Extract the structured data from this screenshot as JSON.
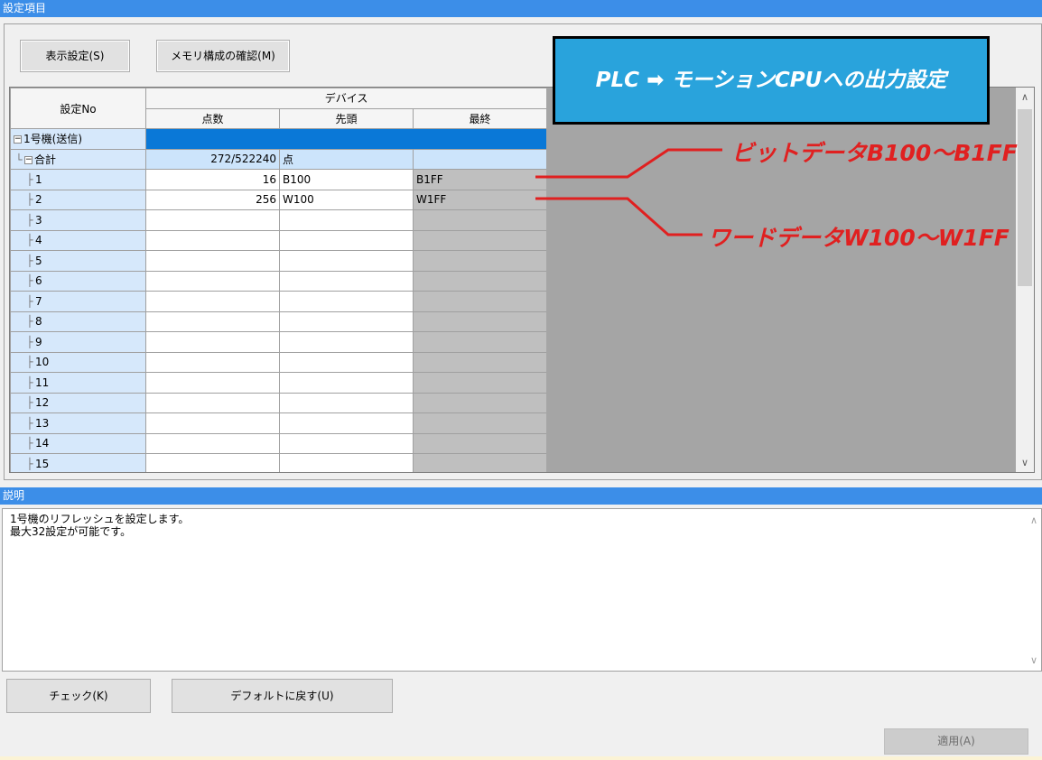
{
  "settings_header": "設定項目",
  "toolbar": {
    "display_settings": "表示設定(S)",
    "memory_check": "メモリ構成の確認(M)"
  },
  "grid": {
    "col_setting_no": "設定No",
    "col_device": "デバイス",
    "col_points": "点数",
    "col_start": "先頭",
    "col_end": "最終",
    "group_label": "1号機(送信)",
    "total_label": "合計",
    "total_points": "272/522240",
    "total_unit": "点",
    "rows": [
      {
        "no": "1",
        "points": "16",
        "start": "B100",
        "end": "B1FF"
      },
      {
        "no": "2",
        "points": "256",
        "start": "W100",
        "end": "W1FF"
      },
      {
        "no": "3",
        "points": "",
        "start": "",
        "end": ""
      },
      {
        "no": "4",
        "points": "",
        "start": "",
        "end": ""
      },
      {
        "no": "5",
        "points": "",
        "start": "",
        "end": ""
      },
      {
        "no": "6",
        "points": "",
        "start": "",
        "end": ""
      },
      {
        "no": "7",
        "points": "",
        "start": "",
        "end": ""
      },
      {
        "no": "8",
        "points": "",
        "start": "",
        "end": ""
      },
      {
        "no": "9",
        "points": "",
        "start": "",
        "end": ""
      },
      {
        "no": "10",
        "points": "",
        "start": "",
        "end": ""
      },
      {
        "no": "11",
        "points": "",
        "start": "",
        "end": ""
      },
      {
        "no": "12",
        "points": "",
        "start": "",
        "end": ""
      },
      {
        "no": "13",
        "points": "",
        "start": "",
        "end": ""
      },
      {
        "no": "14",
        "points": "",
        "start": "",
        "end": ""
      },
      {
        "no": "15",
        "points": "",
        "start": "",
        "end": ""
      }
    ]
  },
  "callout": "PLC ➡ モーションCPUへの出力設定",
  "annotations": {
    "bit": "ビットデータB100～B1FF",
    "word": "ワードデータW100～W1FF"
  },
  "description_header": "説明",
  "description_lines": [
    "1号機のリフレッシュを設定します。",
    "最大32設定が可能です。"
  ],
  "buttons": {
    "check": "チェック(K)",
    "default": "デフォルトに戻す(U)",
    "apply": "適用(A)"
  },
  "colors": {
    "header_blue": "#3c8ee8",
    "callout_blue": "#29a3dc",
    "annotation_red": "#e02020",
    "selected_row": "#0a78d7"
  }
}
